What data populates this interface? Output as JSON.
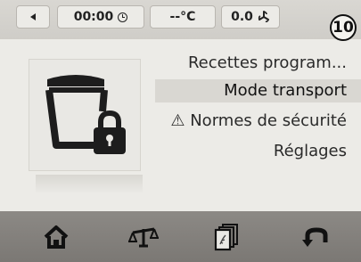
{
  "status": {
    "time": "00:00",
    "temperature": "--°C",
    "fan_speed": "0.0"
  },
  "badge": "10",
  "menu": {
    "items": [
      {
        "label": "Recettes program..."
      },
      {
        "label": "Mode transport"
      },
      {
        "label": "⚠ Normes de sécurité"
      },
      {
        "label": "Réglages"
      }
    ]
  },
  "nav": {
    "icons": [
      "home-icon",
      "scale-icon",
      "recipe-cards-icon",
      "back-return-icon"
    ]
  }
}
